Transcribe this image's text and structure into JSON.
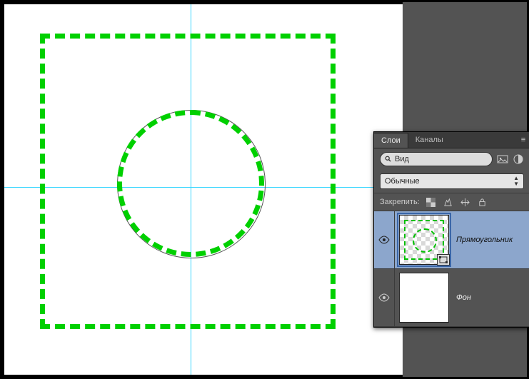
{
  "panel": {
    "tabs": {
      "layers": "Слои",
      "channels": "Каналы"
    },
    "search_placeholder": "Вид",
    "blend_mode": "Обычные",
    "lock_label": "Закрепить:"
  },
  "layers": [
    {
      "name": "Прямоугольник",
      "selected": true,
      "kind": "shape"
    },
    {
      "name": "Фон",
      "selected": false,
      "kind": "bg"
    }
  ]
}
